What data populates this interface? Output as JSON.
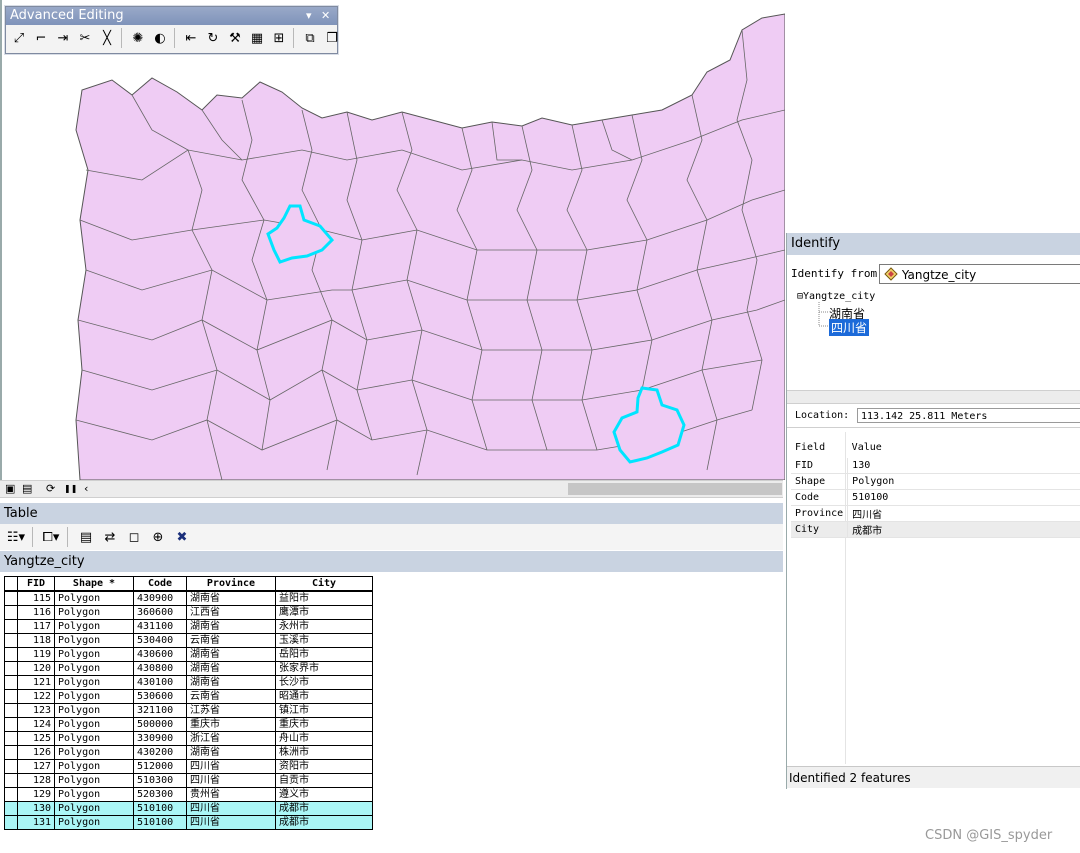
{
  "editing_toolbar": {
    "title": "Advanced Editing",
    "menu_glyph": "▾",
    "close_glyph": "✕",
    "tools": [
      {
        "icon": "copy-features-icon",
        "glyph": "⤢"
      },
      {
        "icon": "fillet-icon",
        "glyph": "⌐"
      },
      {
        "icon": "extend-icon",
        "glyph": "⇥"
      },
      {
        "icon": "trim-icon",
        "glyph": "✂"
      },
      {
        "icon": "line-intersection-icon",
        "glyph": "╳"
      },
      {
        "icon": "explode-icon",
        "glyph": "✺"
      },
      {
        "icon": "generalize-icon",
        "glyph": "◐"
      },
      {
        "icon": "align-to-shape-icon",
        "glyph": "⇤"
      },
      {
        "icon": "rotate-icon",
        "glyph": "↻"
      },
      {
        "icon": "replace-geometry-icon",
        "glyph": "⚒"
      },
      {
        "icon": "construct-features-icon",
        "glyph": "▦"
      },
      {
        "icon": "construct-points-icon",
        "glyph": "⊞"
      },
      {
        "icon": "merge-icon",
        "glyph": "⧉"
      },
      {
        "icon": "union-icon",
        "glyph": "❐"
      }
    ]
  },
  "map_strip": {
    "layout_view_icon": "▣",
    "data_view_icon": "▤",
    "refresh_icon": "⟳",
    "pause_icon": "❚❚",
    "scroll_left_icon": "‹"
  },
  "table": {
    "window_title": "Table",
    "toolbar": [
      {
        "icon": "table-options-icon",
        "glyph": "☷▾"
      },
      {
        "icon": "related-tables-icon",
        "glyph": "⧠▾"
      },
      {
        "icon": "select-by-attributes-icon",
        "glyph": "▤"
      },
      {
        "icon": "switch-selection-icon",
        "glyph": "⇄"
      },
      {
        "icon": "clear-selection-icon",
        "glyph": "◻"
      },
      {
        "icon": "zoom-to-selected-icon",
        "glyph": "⊕"
      },
      {
        "icon": "delete-selected-icon",
        "glyph": "✖"
      }
    ],
    "tab_name": "Yangtze_city",
    "columns": [
      "FID",
      "Shape *",
      "Code",
      "Province",
      "City"
    ],
    "rows": [
      {
        "fid": "115",
        "shape": "Polygon",
        "code": "430900",
        "province": "湖南省",
        "city": "益阳市"
      },
      {
        "fid": "116",
        "shape": "Polygon",
        "code": "360600",
        "province": "江西省",
        "city": "鹰潭市"
      },
      {
        "fid": "117",
        "shape": "Polygon",
        "code": "431100",
        "province": "湖南省",
        "city": "永州市"
      },
      {
        "fid": "118",
        "shape": "Polygon",
        "code": "530400",
        "province": "云南省",
        "city": "玉溪市"
      },
      {
        "fid": "119",
        "shape": "Polygon",
        "code": "430600",
        "province": "湖南省",
        "city": "岳阳市"
      },
      {
        "fid": "120",
        "shape": "Polygon",
        "code": "430800",
        "province": "湖南省",
        "city": "张家界市"
      },
      {
        "fid": "121",
        "shape": "Polygon",
        "code": "430100",
        "province": "湖南省",
        "city": "长沙市"
      },
      {
        "fid": "122",
        "shape": "Polygon",
        "code": "530600",
        "province": "云南省",
        "city": "昭通市"
      },
      {
        "fid": "123",
        "shape": "Polygon",
        "code": "321100",
        "province": "江苏省",
        "city": "镇江市"
      },
      {
        "fid": "124",
        "shape": "Polygon",
        "code": "500000",
        "province": "重庆市",
        "city": "重庆市"
      },
      {
        "fid": "125",
        "shape": "Polygon",
        "code": "330900",
        "province": "浙江省",
        "city": "舟山市"
      },
      {
        "fid": "126",
        "shape": "Polygon",
        "code": "430200",
        "province": "湖南省",
        "city": "株洲市"
      },
      {
        "fid": "127",
        "shape": "Polygon",
        "code": "512000",
        "province": "四川省",
        "city": "资阳市"
      },
      {
        "fid": "128",
        "shape": "Polygon",
        "code": "510300",
        "province": "四川省",
        "city": "自贡市"
      },
      {
        "fid": "129",
        "shape": "Polygon",
        "code": "520300",
        "province": "贵州省",
        "city": "遵义市"
      },
      {
        "fid": "130",
        "shape": "Polygon",
        "code": "510100",
        "province": "四川省",
        "city": "成都市",
        "selected": true
      },
      {
        "fid": "131",
        "shape": "Polygon",
        "code": "510100",
        "province": "四川省",
        "city": "成都市",
        "selected": true
      }
    ],
    "highlight_color": "#aaf6f6"
  },
  "identify": {
    "window_title": "Identify",
    "from_label": "Identify from:",
    "from_value": "Yangtze_city",
    "layer_icon": "layer-diamond-icon",
    "tree": {
      "root": "Yangtze_city",
      "expander": "⊟",
      "items": [
        "湖南省",
        "四川省"
      ],
      "selected_index": 1
    },
    "location_label": "Location:",
    "location_value": "113.142  25.811 Meters",
    "attributes_header": {
      "field": "Field",
      "value": "Value"
    },
    "attributes": [
      {
        "field": "FID",
        "value": "130"
      },
      {
        "field": "Shape",
        "value": "Polygon"
      },
      {
        "field": "Code",
        "value": "510100"
      },
      {
        "field": "Province",
        "value": "四川省"
      },
      {
        "field": "City",
        "value": "成都市"
      }
    ],
    "status": "Identified 2 features"
  },
  "map": {
    "polygon_fill": "#efccf4",
    "boundary_color": "#555555",
    "selection_color": "#00e5ff"
  },
  "watermark": "CSDN @GIS_spyder"
}
